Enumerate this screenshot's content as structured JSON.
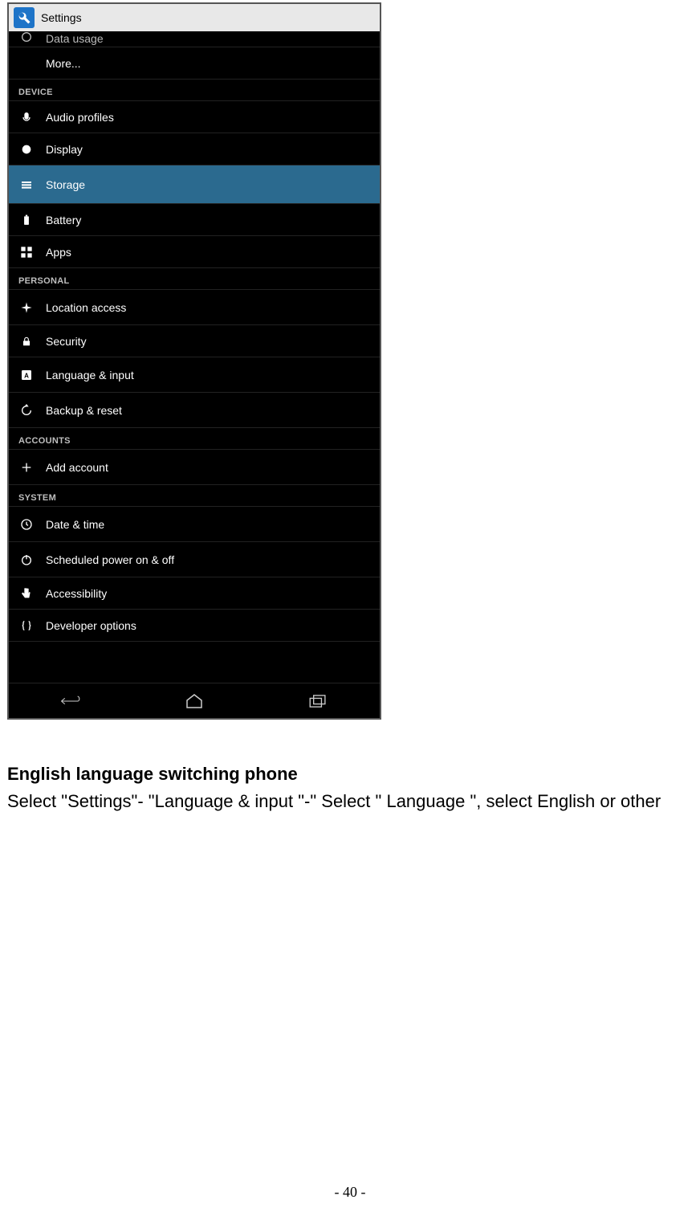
{
  "screenshot": {
    "app_title": "Settings",
    "cutoff_item": "Data usage",
    "more_item": "More...",
    "sections": {
      "device": "DEVICE",
      "personal": "PERSONAL",
      "accounts": "ACCOUNTS",
      "system": "SYSTEM"
    },
    "items": {
      "audio_profiles": "Audio profiles",
      "display": "Display",
      "storage": "Storage",
      "battery": "Battery",
      "apps": "Apps",
      "location_access": "Location access",
      "security": "Security",
      "language_input": "Language & input",
      "backup_reset": "Backup & reset",
      "add_account": "Add account",
      "date_time": "Date & time",
      "scheduled_power": "Scheduled power on & off",
      "accessibility": "Accessibility",
      "developer_options": "Developer options"
    }
  },
  "doc": {
    "heading": "English language switching phone",
    "body": "Select \"Settings\"- \"Language & input \"-\" Select \" Language \", select English or other",
    "page_number": "- 40 -"
  }
}
